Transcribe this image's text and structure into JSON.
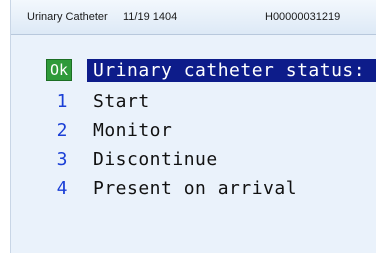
{
  "titlebar": {
    "name": "Urinary Catheter",
    "datetime": "11/19 1404",
    "record_id": "H00000031219"
  },
  "menu": {
    "ok_label": "Ok",
    "heading": "Urinary catheter status:",
    "options": [
      {
        "number": "1",
        "label": "Start"
      },
      {
        "number": "2",
        "label": "Monitor"
      },
      {
        "number": "3",
        "label": "Discontinue"
      },
      {
        "number": "4",
        "label": "Present on arrival"
      }
    ]
  },
  "colors": {
    "heading_bg": "#0d1c8a",
    "ok_bg": "#2f9a3a",
    "option_number": "#1a3fd6",
    "window_bg": "#eaf2fb"
  }
}
